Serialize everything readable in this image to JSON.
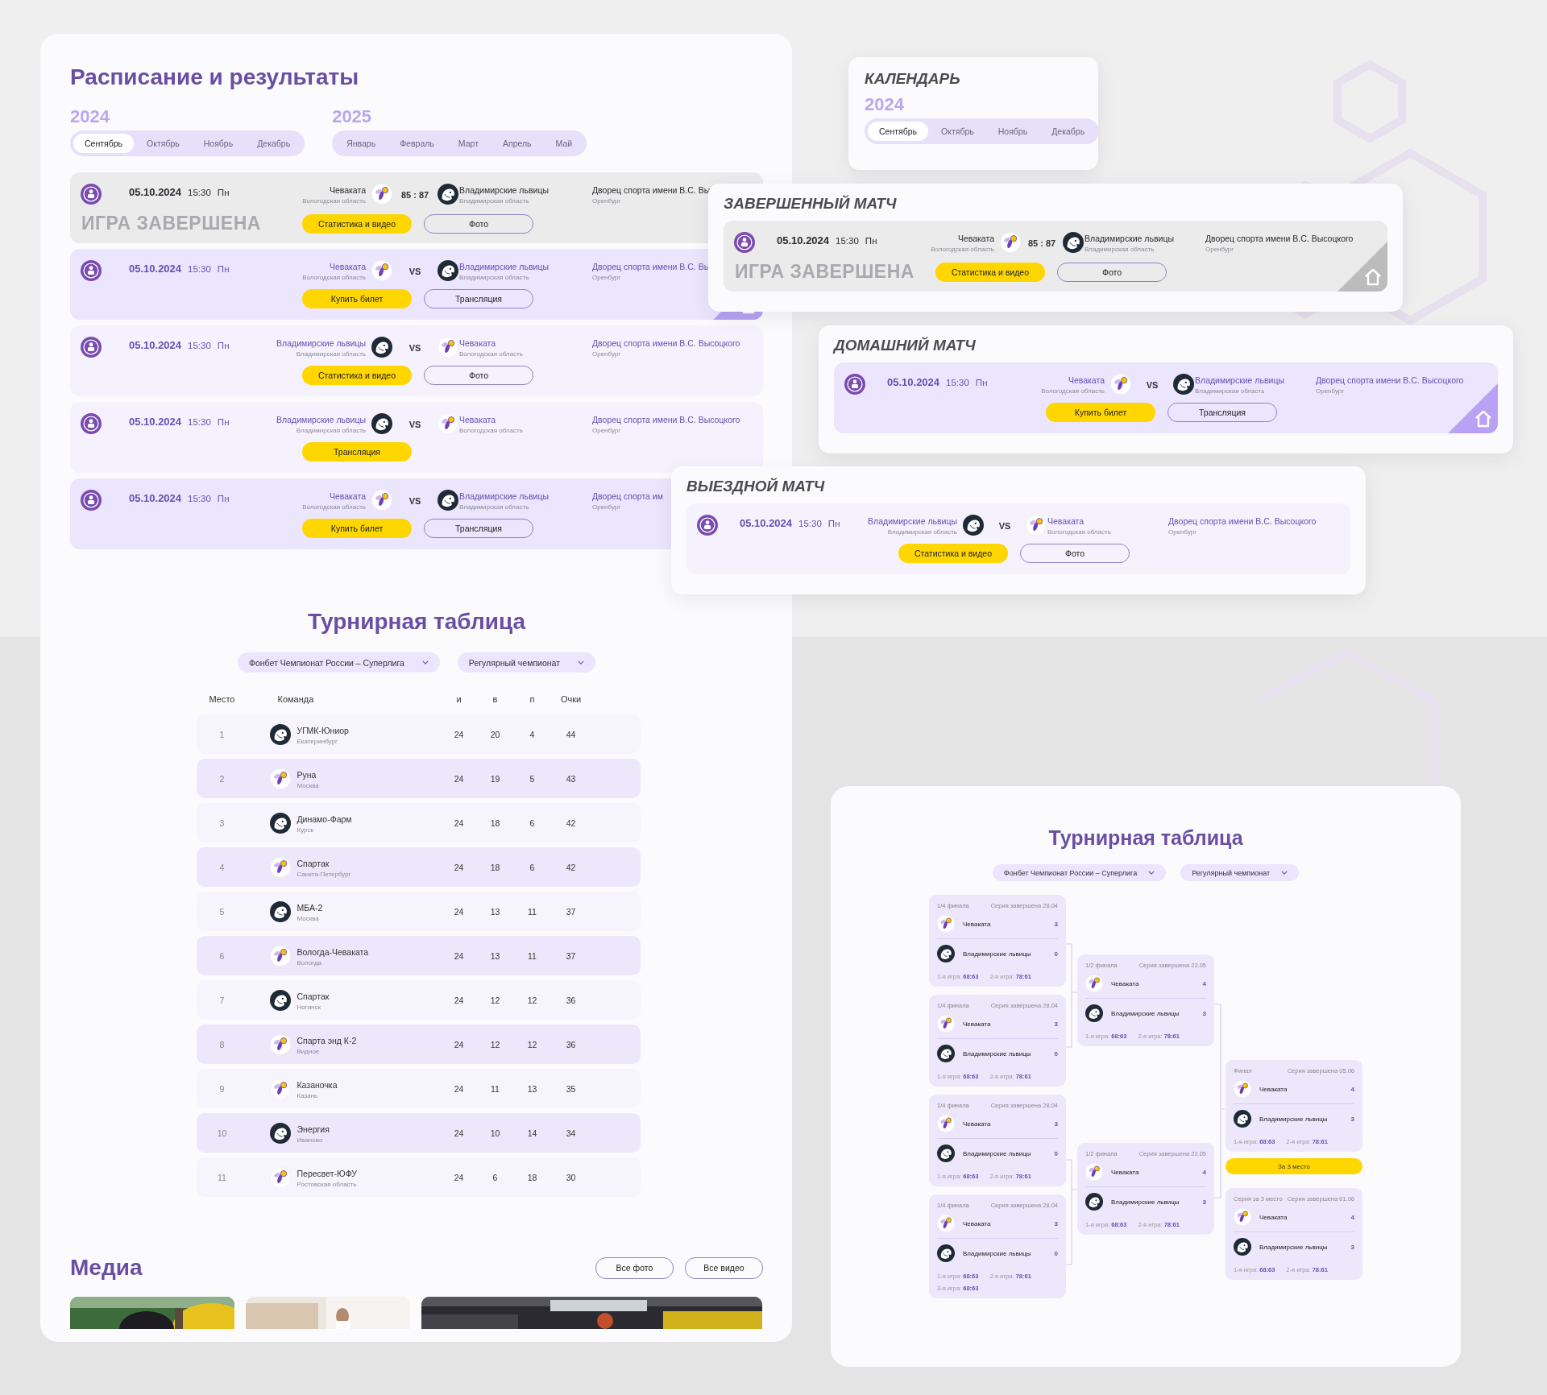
{
  "schedule": {
    "title": "Расписание и результаты",
    "years": [
      {
        "year": "2024",
        "months": [
          {
            "label": "Сентябрь",
            "selected": true
          },
          {
            "label": "Октябрь",
            "selected": false
          },
          {
            "label": "Ноябрь",
            "selected": false
          },
          {
            "label": "Декабрь",
            "selected": false
          }
        ]
      },
      {
        "year": "2025",
        "months": [
          {
            "label": "Январь",
            "selected": false
          },
          {
            "label": "Февраль",
            "selected": false
          },
          {
            "label": "Март",
            "selected": false
          },
          {
            "label": "Апрель",
            "selected": false
          },
          {
            "label": "Май",
            "selected": false
          }
        ]
      }
    ],
    "matches": [
      {
        "kind": "finished",
        "date": "05.10.2024",
        "time": "15:30",
        "weekday": "Пн",
        "home": {
          "name": "Чеваката",
          "region": "Вологодская область",
          "kind": "light"
        },
        "away": {
          "name": "Владимирские львицы",
          "region": "Владимирская область",
          "kind": "dark"
        },
        "score": "85 : 87",
        "venue": "Дворец спорта имени В.С. Вы",
        "city": "Оренбург",
        "status": "ИГРА ЗАВЕРШЕНА",
        "home_badge": false,
        "buttons": [
          {
            "label": "Статистика и видео",
            "kind": "primary"
          },
          {
            "label": "Фото",
            "kind": "outline"
          }
        ]
      },
      {
        "kind": "home",
        "date": "05.10.2024",
        "time": "15:30",
        "weekday": "Пн",
        "home": {
          "name": "Чеваката",
          "region": "Вологодская область",
          "kind": "light"
        },
        "away": {
          "name": "Владимирские львицы",
          "region": "Владимирская область",
          "kind": "dark"
        },
        "versus": "VS",
        "venue": "Дворец спорта имени В.С. Вы",
        "city": "Оренбург",
        "home_badge": true,
        "buttons": [
          {
            "label": "Купить билет",
            "kind": "primary"
          },
          {
            "label": "Трансляция",
            "kind": "outline"
          }
        ]
      },
      {
        "kind": "away",
        "date": "05.10.2024",
        "time": "15:30",
        "weekday": "Пн",
        "home": {
          "name": "Владимирские львицы",
          "region": "Владимирская область",
          "kind": "dark"
        },
        "away": {
          "name": "Чеваката",
          "region": "Вологодская область",
          "kind": "light"
        },
        "versus": "VS",
        "venue": "Дворец спорта имени В.С. Высоцкого",
        "city": "Оренбург",
        "home_badge": false,
        "buttons": [
          {
            "label": "Статистика и видео",
            "kind": "primary"
          },
          {
            "label": "Фото",
            "kind": "outline"
          }
        ]
      },
      {
        "kind": "away",
        "date": "05.10.2024",
        "time": "15:30",
        "weekday": "Пн",
        "home": {
          "name": "Владимирские львицы",
          "region": "Владимирская область",
          "kind": "dark"
        },
        "away": {
          "name": "Чеваката",
          "region": "Вологодская область",
          "kind": "light"
        },
        "versus": "VS",
        "venue": "Дворец спорта имени В.С. Высоцкого",
        "city": "Оренбург",
        "home_badge": false,
        "buttons": [
          {
            "label": "Трансляция",
            "kind": "primary"
          }
        ]
      },
      {
        "kind": "home",
        "date": "05.10.2024",
        "time": "15:30",
        "weekday": "Пн",
        "home": {
          "name": "Чеваката",
          "region": "Вологодская область",
          "kind": "light"
        },
        "away": {
          "name": "Владимирские львицы",
          "region": "Владимирская область",
          "kind": "dark"
        },
        "versus": "VS",
        "venue": "Дворец спорта им",
        "city": "Оренбург",
        "home_badge": false,
        "buttons": [
          {
            "label": "Купить билет",
            "kind": "primary"
          },
          {
            "label": "Трансляция",
            "kind": "outline"
          }
        ]
      }
    ]
  },
  "standings": {
    "title": "Турнирная таблица",
    "filters": [
      "Фонбет Чемпионат России – Суперлига",
      "Регулярный чемпионат"
    ],
    "columns": [
      "Место",
      "Команда",
      "и",
      "в",
      "п",
      "Очки"
    ],
    "rows": [
      {
        "place": "1",
        "team": "УГМК-Юниор",
        "city": "Екатеринбург",
        "kind": "dark",
        "games": "24",
        "wins": "20",
        "losses": "4",
        "points": "44"
      },
      {
        "place": "2",
        "team": "Руна",
        "city": "Москва",
        "kind": "light",
        "games": "24",
        "wins": "19",
        "losses": "5",
        "points": "43"
      },
      {
        "place": "3",
        "team": "Динамо-Фарм",
        "city": "Курск",
        "kind": "dark",
        "games": "24",
        "wins": "18",
        "losses": "6",
        "points": "42"
      },
      {
        "place": "4",
        "team": "Спартак",
        "city": "Санкта-Петербург",
        "kind": "light",
        "games": "24",
        "wins": "18",
        "losses": "6",
        "points": "42"
      },
      {
        "place": "5",
        "team": "МБА-2",
        "city": "Москва",
        "kind": "dark",
        "games": "24",
        "wins": "13",
        "losses": "11",
        "points": "37"
      },
      {
        "place": "6",
        "team": "Вологда-Чеваката",
        "city": "Вологда",
        "kind": "light",
        "games": "24",
        "wins": "13",
        "losses": "11",
        "points": "37"
      },
      {
        "place": "7",
        "team": "Спартак",
        "city": "Ногинск",
        "kind": "dark",
        "games": "24",
        "wins": "12",
        "losses": "12",
        "points": "36"
      },
      {
        "place": "8",
        "team": "Спарта энд К-2",
        "city": "Видное",
        "kind": "light",
        "games": "24",
        "wins": "12",
        "losses": "12",
        "points": "36"
      },
      {
        "place": "9",
        "team": "Казаночка",
        "city": "Казань",
        "kind": "light",
        "games": "24",
        "wins": "11",
        "losses": "13",
        "points": "35"
      },
      {
        "place": "10",
        "team": "Энергия",
        "city": "Иваново",
        "kind": "dark",
        "games": "24",
        "wins": "10",
        "losses": "14",
        "points": "34"
      },
      {
        "place": "11",
        "team": "Пересвет-ЮФУ",
        "city": "Ростовская область",
        "kind": "light",
        "games": "24",
        "wins": "6",
        "losses": "18",
        "points": "30"
      }
    ]
  },
  "media": {
    "title": "Медиа",
    "buttons": [
      "Все фото",
      "Все видео"
    ],
    "photos": [
      {
        "kind": "picture"
      },
      {
        "kind": "picture"
      },
      {
        "kind": "picture"
      }
    ]
  },
  "calendar_card": {
    "title": "КАЛЕНДАРЬ",
    "year": "2024",
    "months": [
      {
        "label": "Сентябрь",
        "selected": true
      },
      {
        "label": "Октябрь",
        "selected": false
      },
      {
        "label": "Ноябрь",
        "selected": false
      },
      {
        "label": "Декабрь",
        "selected": false
      }
    ]
  },
  "match_cards": [
    {
      "title": "ЗАВЕРШЕННЫЙ МАТЧ",
      "match": {
        "kind": "finished",
        "date": "05.10.2024",
        "time": "15:30",
        "weekday": "Пн",
        "home": {
          "name": "Чеваката",
          "region": "Вологодская область",
          "kind": "light"
        },
        "away": {
          "name": "Владимирские львицы",
          "region": "Владимирская область",
          "kind": "dark"
        },
        "score": "85 : 87",
        "venue": "Дворец спорта имени В.С. Высоцкого",
        "city": "Оренбург",
        "status": "ИГРА ЗАВЕРШЕНА",
        "home_badge": true,
        "buttons": [
          {
            "label": "Статистика и видео",
            "kind": "primary"
          },
          {
            "label": "Фото",
            "kind": "outline"
          }
        ]
      }
    },
    {
      "title": "ДОМАШНИЙ МАТЧ",
      "match": {
        "kind": "home",
        "date": "05.10.2024",
        "time": "15:30",
        "weekday": "Пн",
        "home": {
          "name": "Чеваката",
          "region": "Вологодская область",
          "kind": "light"
        },
        "away": {
          "name": "Владимирские львицы",
          "region": "Владимирская область",
          "kind": "dark"
        },
        "versus": "VS",
        "venue": "Дворец спорта имени В.С. Высоцкого",
        "city": "Оренбург",
        "home_badge": true,
        "buttons": [
          {
            "label": "Купить билет",
            "kind": "primary"
          },
          {
            "label": "Трансляция",
            "kind": "outline"
          }
        ]
      }
    },
    {
      "title": "ВЫЕЗДНОЙ МАТЧ",
      "match": {
        "kind": "away",
        "date": "05.10.2024",
        "time": "15:30",
        "weekday": "Пн",
        "home": {
          "name": "Владимирские львицы",
          "region": "Владимирская область",
          "kind": "dark"
        },
        "away": {
          "name": "Чеваката",
          "region": "Вологодская область",
          "kind": "light"
        },
        "versus": "VS",
        "venue": "Дворец спорта имени В.С. Высоцкого",
        "city": "Оренбург",
        "home_badge": false,
        "buttons": [
          {
            "label": "Статистика и видео",
            "kind": "primary"
          },
          {
            "label": "Фото",
            "kind": "outline"
          }
        ]
      }
    }
  ],
  "bracket": {
    "title": "Турнирная таблица",
    "filters": [
      "Фонбет Чемпионат России – Суперлига",
      "Регулярный чемпионат"
    ],
    "quarterfinals": [
      {
        "stage": "1/4 финала",
        "status": "Серия завершена 28.04",
        "teams": [
          {
            "name": "Чеваката",
            "kind": "light",
            "score": "3"
          },
          {
            "name": "Владимирские львицы",
            "kind": "dark",
            "score": "0"
          }
        ],
        "game_lines": [
          [
            {
              "label": "1-я игра:",
              "score": "68:63"
            },
            {
              "label": "2-я игра:",
              "score": "78:61"
            }
          ]
        ]
      },
      {
        "stage": "1/4 финала",
        "status": "Серия завершена 28.04",
        "teams": [
          {
            "name": "Чеваката",
            "kind": "light",
            "score": "3"
          },
          {
            "name": "Владимирские львицы",
            "kind": "dark",
            "score": "0"
          }
        ],
        "game_lines": [
          [
            {
              "label": "1-я игра:",
              "score": "68:63"
            },
            {
              "label": "2-я игра:",
              "score": "78:61"
            }
          ]
        ]
      },
      {
        "stage": "1/4 финала",
        "status": "Серия завершена 28.04",
        "teams": [
          {
            "name": "Чеваката",
            "kind": "light",
            "score": "3"
          },
          {
            "name": "Владимирские львицы",
            "kind": "dark",
            "score": "0"
          }
        ],
        "game_lines": [
          [
            {
              "label": "1-я игра:",
              "score": "68:63"
            },
            {
              "label": "2-я игра:",
              "score": "78:61"
            }
          ]
        ]
      },
      {
        "stage": "1/4 финала",
        "status": "Серия завершена 28.04",
        "teams": [
          {
            "name": "Чеваката",
            "kind": "light",
            "score": "3"
          },
          {
            "name": "Владимирские львицы",
            "kind": "dark",
            "score": "0"
          }
        ],
        "game_lines": [
          [
            {
              "label": "1-я игра:",
              "score": "68:63"
            },
            {
              "label": "2-я игра:",
              "score": "78:61"
            }
          ],
          [
            {
              "label": "3-я игра:",
              "score": "68:63"
            }
          ]
        ]
      }
    ],
    "semifinals": [
      {
        "stage": "1/2 финала",
        "status": "Серия завершена 22.05",
        "teams": [
          {
            "name": "Чеваката",
            "kind": "light",
            "score": "4"
          },
          {
            "name": "Владимирские львицы",
            "kind": "dark",
            "score": "3"
          }
        ],
        "game_lines": [
          [
            {
              "label": "1-я игра:",
              "score": "68:63"
            },
            {
              "label": "2-я игра:",
              "score": "78:61"
            }
          ]
        ]
      },
      {
        "stage": "1/2 финала",
        "status": "Серия завершена 22.05",
        "teams": [
          {
            "name": "Чеваката",
            "kind": "light",
            "score": "4"
          },
          {
            "name": "Владимирские львицы",
            "kind": "dark",
            "score": "3"
          }
        ],
        "game_lines": [
          [
            {
              "label": "1-я игра:",
              "score": "68:63"
            },
            {
              "label": "2-я игра:",
              "score": "78:61"
            }
          ]
        ]
      }
    ],
    "final": {
      "stage": "Финал",
      "status": "Серия завершена 05.06",
      "teams": [
        {
          "name": "Чеваката",
          "kind": "light",
          "score": "4"
        },
        {
          "name": "Владимирские львицы",
          "kind": "dark",
          "score": "3"
        }
      ],
      "game_lines": [
        [
          {
            "label": "1-я игра:",
            "score": "68:63"
          },
          {
            "label": "2-я игра:",
            "score": "78:61"
          }
        ]
      ]
    },
    "third_place_button": "За 3 место",
    "third_place": {
      "stage": "Серия за 3 место",
      "status": "Серия завершена 01.06",
      "teams": [
        {
          "name": "Чеваката",
          "kind": "light",
          "score": "4"
        },
        {
          "name": "Владимирские львицы",
          "kind": "dark",
          "score": "3"
        }
      ],
      "game_lines": [
        [
          {
            "label": "1-я игра:",
            "score": "68:63"
          },
          {
            "label": "2-я игра:",
            "score": "78:61"
          }
        ]
      ]
    }
  }
}
